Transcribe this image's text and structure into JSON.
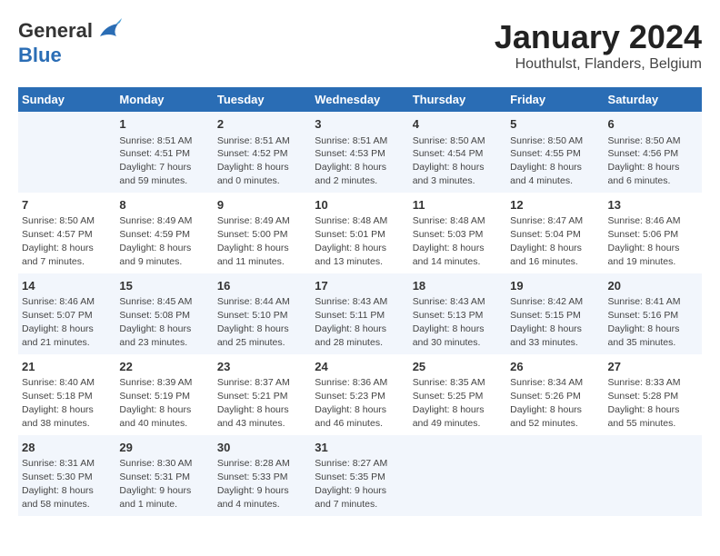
{
  "logo": {
    "general": "General",
    "blue": "Blue"
  },
  "title": "January 2024",
  "subtitle": "Houthulst, Flanders, Belgium",
  "weekdays": [
    "Sunday",
    "Monday",
    "Tuesday",
    "Wednesday",
    "Thursday",
    "Friday",
    "Saturday"
  ],
  "weeks": [
    [
      {
        "day": "",
        "info": ""
      },
      {
        "day": "1",
        "info": "Sunrise: 8:51 AM\nSunset: 4:51 PM\nDaylight: 7 hours\nand 59 minutes."
      },
      {
        "day": "2",
        "info": "Sunrise: 8:51 AM\nSunset: 4:52 PM\nDaylight: 8 hours\nand 0 minutes."
      },
      {
        "day": "3",
        "info": "Sunrise: 8:51 AM\nSunset: 4:53 PM\nDaylight: 8 hours\nand 2 minutes."
      },
      {
        "day": "4",
        "info": "Sunrise: 8:50 AM\nSunset: 4:54 PM\nDaylight: 8 hours\nand 3 minutes."
      },
      {
        "day": "5",
        "info": "Sunrise: 8:50 AM\nSunset: 4:55 PM\nDaylight: 8 hours\nand 4 minutes."
      },
      {
        "day": "6",
        "info": "Sunrise: 8:50 AM\nSunset: 4:56 PM\nDaylight: 8 hours\nand 6 minutes."
      }
    ],
    [
      {
        "day": "7",
        "info": "Sunrise: 8:50 AM\nSunset: 4:57 PM\nDaylight: 8 hours\nand 7 minutes."
      },
      {
        "day": "8",
        "info": "Sunrise: 8:49 AM\nSunset: 4:59 PM\nDaylight: 8 hours\nand 9 minutes."
      },
      {
        "day": "9",
        "info": "Sunrise: 8:49 AM\nSunset: 5:00 PM\nDaylight: 8 hours\nand 11 minutes."
      },
      {
        "day": "10",
        "info": "Sunrise: 8:48 AM\nSunset: 5:01 PM\nDaylight: 8 hours\nand 13 minutes."
      },
      {
        "day": "11",
        "info": "Sunrise: 8:48 AM\nSunset: 5:03 PM\nDaylight: 8 hours\nand 14 minutes."
      },
      {
        "day": "12",
        "info": "Sunrise: 8:47 AM\nSunset: 5:04 PM\nDaylight: 8 hours\nand 16 minutes."
      },
      {
        "day": "13",
        "info": "Sunrise: 8:46 AM\nSunset: 5:06 PM\nDaylight: 8 hours\nand 19 minutes."
      }
    ],
    [
      {
        "day": "14",
        "info": "Sunrise: 8:46 AM\nSunset: 5:07 PM\nDaylight: 8 hours\nand 21 minutes."
      },
      {
        "day": "15",
        "info": "Sunrise: 8:45 AM\nSunset: 5:08 PM\nDaylight: 8 hours\nand 23 minutes."
      },
      {
        "day": "16",
        "info": "Sunrise: 8:44 AM\nSunset: 5:10 PM\nDaylight: 8 hours\nand 25 minutes."
      },
      {
        "day": "17",
        "info": "Sunrise: 8:43 AM\nSunset: 5:11 PM\nDaylight: 8 hours\nand 28 minutes."
      },
      {
        "day": "18",
        "info": "Sunrise: 8:43 AM\nSunset: 5:13 PM\nDaylight: 8 hours\nand 30 minutes."
      },
      {
        "day": "19",
        "info": "Sunrise: 8:42 AM\nSunset: 5:15 PM\nDaylight: 8 hours\nand 33 minutes."
      },
      {
        "day": "20",
        "info": "Sunrise: 8:41 AM\nSunset: 5:16 PM\nDaylight: 8 hours\nand 35 minutes."
      }
    ],
    [
      {
        "day": "21",
        "info": "Sunrise: 8:40 AM\nSunset: 5:18 PM\nDaylight: 8 hours\nand 38 minutes."
      },
      {
        "day": "22",
        "info": "Sunrise: 8:39 AM\nSunset: 5:19 PM\nDaylight: 8 hours\nand 40 minutes."
      },
      {
        "day": "23",
        "info": "Sunrise: 8:37 AM\nSunset: 5:21 PM\nDaylight: 8 hours\nand 43 minutes."
      },
      {
        "day": "24",
        "info": "Sunrise: 8:36 AM\nSunset: 5:23 PM\nDaylight: 8 hours\nand 46 minutes."
      },
      {
        "day": "25",
        "info": "Sunrise: 8:35 AM\nSunset: 5:25 PM\nDaylight: 8 hours\nand 49 minutes."
      },
      {
        "day": "26",
        "info": "Sunrise: 8:34 AM\nSunset: 5:26 PM\nDaylight: 8 hours\nand 52 minutes."
      },
      {
        "day": "27",
        "info": "Sunrise: 8:33 AM\nSunset: 5:28 PM\nDaylight: 8 hours\nand 55 minutes."
      }
    ],
    [
      {
        "day": "28",
        "info": "Sunrise: 8:31 AM\nSunset: 5:30 PM\nDaylight: 8 hours\nand 58 minutes."
      },
      {
        "day": "29",
        "info": "Sunrise: 8:30 AM\nSunset: 5:31 PM\nDaylight: 9 hours\nand 1 minute."
      },
      {
        "day": "30",
        "info": "Sunrise: 8:28 AM\nSunset: 5:33 PM\nDaylight: 9 hours\nand 4 minutes."
      },
      {
        "day": "31",
        "info": "Sunrise: 8:27 AM\nSunset: 5:35 PM\nDaylight: 9 hours\nand 7 minutes."
      },
      {
        "day": "",
        "info": ""
      },
      {
        "day": "",
        "info": ""
      },
      {
        "day": "",
        "info": ""
      }
    ]
  ]
}
